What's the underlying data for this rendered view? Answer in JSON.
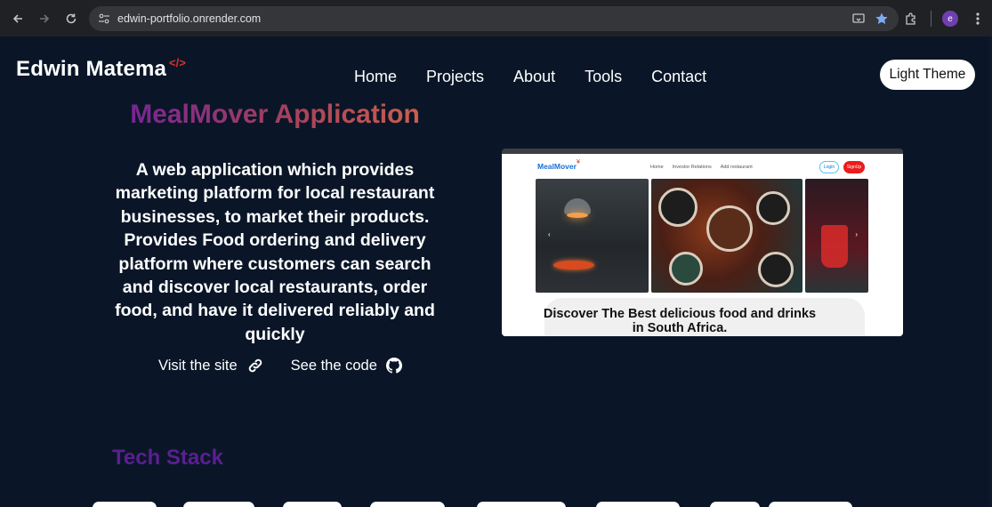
{
  "browser": {
    "url": "edwin-portfolio.onrender.com",
    "profile_initial": "e"
  },
  "header": {
    "logo_text": "Edwin Matema",
    "logo_mark": "</>",
    "nav": [
      "Home",
      "Projects",
      "About",
      "Tools",
      "Contact"
    ],
    "theme_button": "Light Theme"
  },
  "project": {
    "title": "MealMover Application",
    "description": "A web application which provides marketing platform for local restaurant businesses, to market their products. Provides Food ordering and delivery platform where customers can search and discover local restaurants, order food, and have it delivered reliably and quickly",
    "visit_label": "Visit the site",
    "code_label": "See the code",
    "preview": {
      "logo": "MealMover",
      "logo_mark": "¥",
      "links": [
        "Home",
        "Investor Relations",
        "Add restaurant"
      ],
      "login": "Login",
      "signup": "SignUp",
      "hero_text": "Discover The Best delicious food and drinks in South Africa."
    }
  },
  "tech": {
    "title": "Tech Stack"
  },
  "colors": {
    "background": "#0a1628",
    "title_gradient_start": "#6a1fa0",
    "title_gradient_end": "#d9684a",
    "tech_title": "#5b1f90"
  }
}
